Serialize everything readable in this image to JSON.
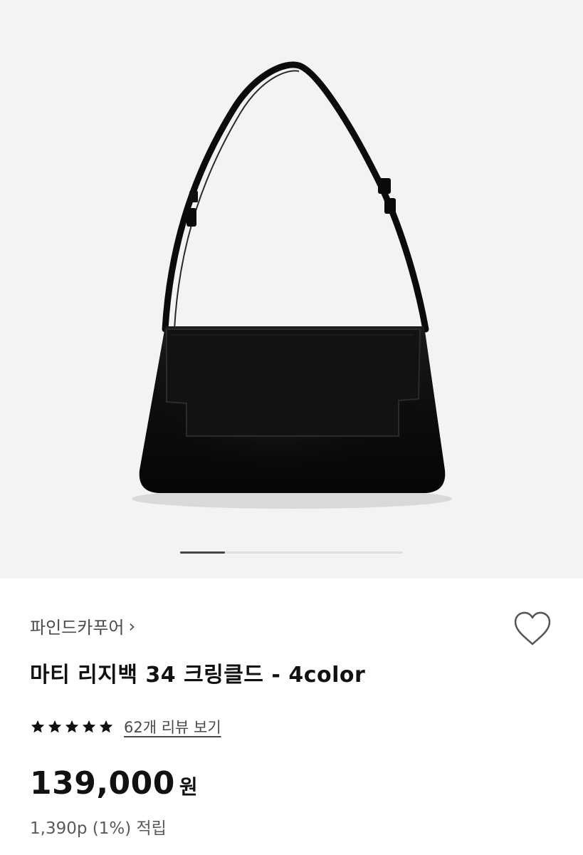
{
  "gallery": {
    "image_alt": "black shoulder bag",
    "indicator_progress": 0.2
  },
  "product": {
    "brand": "파인드카푸어",
    "brand_chevron": "›",
    "title": "마티 리지백 34 크링클드 - 4color",
    "rating_stars": 5,
    "review_link": "62개 리뷰 보기",
    "price": "139,000",
    "price_unit": "원",
    "points": "1,390p (1%) 적립"
  },
  "icons": {
    "wish": "heart-outline-icon",
    "star": "star-icon",
    "chevron": "chevron-right-icon"
  },
  "colors": {
    "background": "#f3f3f3",
    "text": "#111111",
    "muted": "#4a4a4a",
    "indicator_active": "#444444",
    "indicator_track": "#dedede"
  }
}
